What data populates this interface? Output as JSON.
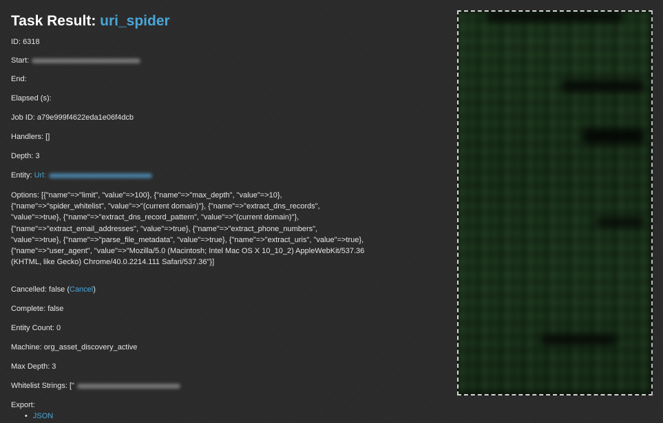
{
  "title": {
    "prefix": "Task Result: ",
    "task_name": "uri_spider"
  },
  "fields": {
    "id": "ID: 6318",
    "start": "Start:",
    "end": "End:",
    "elapsed": "Elapsed (s):",
    "job_id": "Job ID: a79e999f4622eda1e06f4dcb",
    "handlers": "Handlers: []",
    "depth": "Depth: 3",
    "entity_label": "Entity:",
    "entity_type": "Url:",
    "cancelled_prefix": "Cancelled: false (",
    "cancel_link": "Cancel",
    "cancelled_suffix": ")",
    "complete": "Complete: false",
    "entity_count": "Entity Count: 0",
    "machine": "Machine: org_asset_discovery_active",
    "max_depth": "Max Depth: 3",
    "whitelist": "Whitelist Strings: [\"",
    "export_label": "Export:"
  },
  "options_lines": [
    "Options: [{\"name\"=>\"limit\", \"value\"=>100}, {\"name\"=>\"max_depth\", \"value\"=>10},",
    "{\"name\"=>\"spider_whitelist\", \"value\"=>\"(current domain)\"}, {\"name\"=>\"extract_dns_records\",",
    "\"value\"=>true}, {\"name\"=>\"extract_dns_record_pattern\", \"value\"=>\"(current domain)\"},",
    "{\"name\"=>\"extract_email_addresses\", \"value\"=>true}, {\"name\"=>\"extract_phone_numbers\",",
    "\"value\"=>true}, {\"name\"=>\"parse_file_metadata\", \"value\"=>true}, {\"name\"=>\"extract_uris\", \"value\"=>true},",
    "{\"name\"=>\"user_agent\", \"value\"=>\"Mozilla/5.0 (Macintosh; Intel Mac OS X 10_10_2) AppleWebKit/537.36",
    "(KHTML, like Gecko) Chrome/40.0.2214.111 Safari/537.36\"}]"
  ],
  "export_links": [
    "JSON"
  ],
  "colors": {
    "accent": "#49a6d9",
    "background": "#2a2a2a",
    "text": "#e6e6e6"
  }
}
